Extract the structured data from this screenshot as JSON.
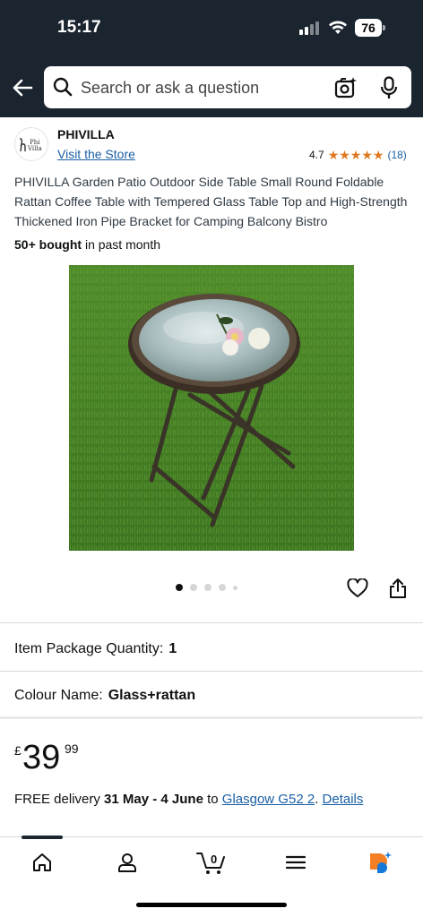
{
  "status_bar": {
    "time": "15:17",
    "battery": "76"
  },
  "search": {
    "placeholder": "Search or ask a question"
  },
  "brand": {
    "logo_text_top": "Phi",
    "logo_text_bottom": "Villa",
    "name": "PHIVILLA",
    "store_link": "Visit the Store"
  },
  "rating": {
    "score": "4.7",
    "stars": "★★★★★",
    "count": "(18)"
  },
  "product": {
    "title": "PHIVILLA Garden Patio Outdoor Side Table Small Round Foldable Rattan Coffee Table with Tempered Glass Table Top and High-Strength Thickened Iron Pipe Bracket for Camping Balcony Bistro",
    "bought_count": "50+ bought",
    "bought_suffix": " in past month"
  },
  "carousel": {
    "total_dots": 5,
    "active_index": 0
  },
  "options": {
    "quantity_label": "Item Package Quantity:",
    "quantity_value": "1",
    "colour_label": "Colour Name:",
    "colour_value": "Glass+rattan"
  },
  "price": {
    "currency": "£",
    "whole": "39",
    "fraction": "99"
  },
  "delivery": {
    "prefix": "FREE delivery ",
    "dates": "31 May - 4 June",
    "to": " to ",
    "location": "Glasgow G52 2",
    "sep": ". ",
    "details": "Details"
  },
  "bottom_nav": {
    "cart_count": "0",
    "icons": [
      "home-icon",
      "account-icon",
      "cart-icon",
      "menu-icon",
      "rufus-icon"
    ]
  },
  "colors": {
    "header_bg": "#1b2530",
    "link": "#1a5fa6",
    "star": "#de7921",
    "rufus_orange": "#f47f24",
    "rufus_blue": "#1678d8"
  }
}
